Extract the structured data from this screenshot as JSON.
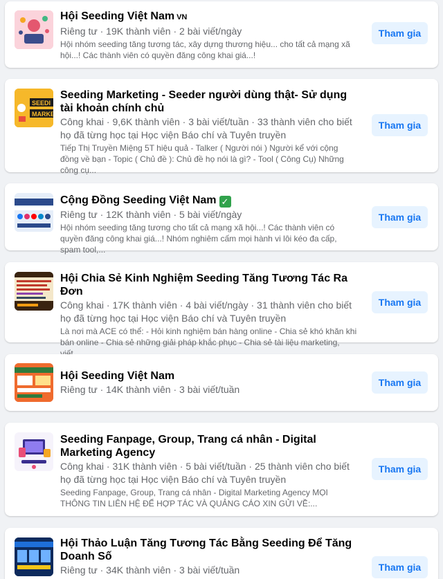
{
  "groups": [
    {
      "name": "Hội Seeding Việt Nam",
      "name_suffix": "VN",
      "meta": "Riêng tư · 19K thành viên · 2 bài viết/ngày",
      "description": "Hội nhóm seeding tăng tương tác, xây dựng thương hiệu... cho tất cả mạng xã hội...! Các thành viên có quyền đăng công khai giá...!",
      "join_label": "Tham gia"
    },
    {
      "name": "Seeding Marketing - Seeder người dùng thật- Sử dụng tài khoản chính chủ",
      "meta": "Công khai · 9,6K thành viên · 3 bài viết/tuần · 33 thành viên cho biết họ đã từng học tại Học viện Báo chí và Tuyên truyền",
      "description": "Tiếp Thị Truyền Miệng 5T hiệu quả - Talker ( Người nói ) Người kể với cộng đồng về bạn - Topic ( Chủ đề ): Chủ đề họ nói là gì? - Tool ( Công Cụ) Những công cụ...",
      "join_label": "Tham gia"
    },
    {
      "name": "Cộng Đồng Seeding Việt Nam",
      "meta": "Riêng tư · 12K thành viên · 5 bài viết/ngày",
      "description": "Hội nhóm seeding tăng tương cho tất cả mạng xã hội...! Các thành viên có quyền đăng công khai giá...! Nhóm nghiêm cấm mọi hành vi lôi kéo đa cấp, spam tool,...",
      "join_label": "Tham gia"
    },
    {
      "name": "Hội Chia Sẻ Kinh Nghiệm Seeding Tăng Tương Tác Ra Đơn",
      "meta": "Công khai · 17K thành viên · 4 bài viết/ngày · 31 thành viên cho biết họ đã từng học tại Học viện Báo chí và Tuyên truyền",
      "description": "Là nơi mà ACE có thể: - Hỏi kinh nghiệm bán hàng online - Chia sẻ khó khăn khi bán online - Chia sẻ những giải pháp khắc phục - Chia sẻ tài liệu marketing, viết...",
      "join_label": "Tham gia"
    },
    {
      "name": "Hội Seeding Việt Nam",
      "meta": "Riêng tư · 14K thành viên · 3 bài viết/tuần",
      "description": "",
      "join_label": "Tham gia"
    },
    {
      "name": "Seeding Fanpage, Group, Trang cá nhân - Digital Marketing Agency",
      "meta": "Công khai · 31K thành viên · 5 bài viết/tuần · 25 thành viên cho biết họ đã từng học tại Học viện Báo chí và Tuyên truyền",
      "description": "Seeding Fanpage, Group, Trang cá nhân - Digital Marketing Agency MỌI THÔNG TIN LIÊN HỆ ĐỂ HỢP TÁC VÀ QUẢNG CÁO XIN GỬI VỀ:...",
      "join_label": "Tham gia"
    },
    {
      "name": "Hội Thảo Luận Tăng Tương Tác Bằng Seeding Để Tăng Doanh Số",
      "meta": "Riêng tư · 34K thành viên · 3 bài viết/tuần",
      "description": "",
      "join_label": "Tham gia"
    }
  ]
}
